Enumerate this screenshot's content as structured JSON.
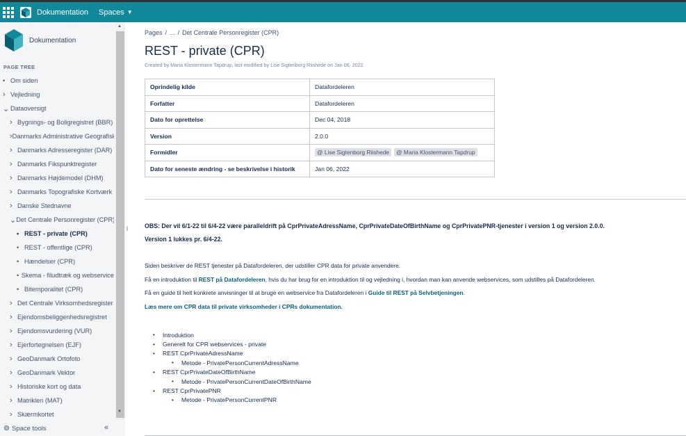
{
  "topbar": {
    "app": "Dokumentation",
    "spaces": "Spaces"
  },
  "sidebar": {
    "space_name": "Dokumentation",
    "page_tree_heading": "PAGE TREE",
    "items": [
      {
        "label": "Om siden",
        "marker": "bullet",
        "indent": 0
      },
      {
        "label": "Vejledning",
        "marker": "closed",
        "indent": 0
      },
      {
        "label": "Dataoversigt",
        "marker": "open",
        "indent": 0
      },
      {
        "label": "Bygnings- og Boligregistret (BBR)",
        "marker": "closed",
        "indent": 1
      },
      {
        "label": "Danmarks Administrative Geografiske Inddeling (DAGI)",
        "marker": "closed",
        "indent": 1
      },
      {
        "label": "Danmarks Adresseregister (DAR)",
        "marker": "closed",
        "indent": 1
      },
      {
        "label": "Danmarks Fikspunktregister",
        "marker": "closed",
        "indent": 1
      },
      {
        "label": "Danmarks Højdemodel (DHM)",
        "marker": "closed",
        "indent": 1
      },
      {
        "label": "Danmarks Topografiske Kortværk",
        "marker": "closed",
        "indent": 1
      },
      {
        "label": "Danske Stednavne",
        "marker": "closed",
        "indent": 1
      },
      {
        "label": "Det Centrale Personregister (CPR)",
        "marker": "open",
        "indent": 1
      },
      {
        "label": "REST - private (CPR)",
        "marker": "bullet",
        "indent": 2,
        "active": true
      },
      {
        "label": "REST - offentlige (CPR)",
        "marker": "bullet",
        "indent": 2
      },
      {
        "label": "Hændelser (CPR)",
        "marker": "bullet",
        "indent": 2
      },
      {
        "label": "Skema - filudtræk og webservice",
        "marker": "bullet",
        "indent": 2
      },
      {
        "label": "Bitemporalitet (CPR)",
        "marker": "bullet",
        "indent": 2
      },
      {
        "label": "Det Centrale Virksomhedsregister",
        "marker": "closed",
        "indent": 1
      },
      {
        "label": "Ejendomsbeliggenhedsregistret",
        "marker": "closed",
        "indent": 1
      },
      {
        "label": "Ejendomsvurdering (VUR)",
        "marker": "closed",
        "indent": 1
      },
      {
        "label": "Ejerfortegnelsen (EJF)",
        "marker": "closed",
        "indent": 1
      },
      {
        "label": "GeoDanmark Ortofoto",
        "marker": "closed",
        "indent": 1
      },
      {
        "label": "GeoDanmark Vektor",
        "marker": "closed",
        "indent": 1
      },
      {
        "label": "Historiske kort og data",
        "marker": "closed",
        "indent": 1
      },
      {
        "label": "Matriklen (MAT)",
        "marker": "closed",
        "indent": 1
      },
      {
        "label": "Skærmkortet",
        "marker": "closed",
        "indent": 1
      }
    ],
    "space_tools": "Space tools",
    "collapse_glyph": "«"
  },
  "breadcrumb": {
    "pages": "Pages",
    "sep": "/",
    "ellipsis": "...",
    "current": "Det Centrale Personregister (CPR)"
  },
  "page": {
    "title": "REST - private (CPR)",
    "byline": "Created by Maria Klostermann Tapdrup, last modified by Lise Sigtenborg Riishede on Jan 06, 2022"
  },
  "meta_table": [
    {
      "key": "Oprindelig kilde",
      "value": "Datafordeleren"
    },
    {
      "key": "Forfatter",
      "value": "Datafordeleren"
    },
    {
      "key": "Dato for oprettelse",
      "value": "Dec 04, 2018"
    },
    {
      "key": "Version",
      "value": "2.0.0"
    },
    {
      "key": "Formidler",
      "mentions": [
        "@ Lise Sigtenborg Riishede",
        "@ Maria Klostermann Tapdrup"
      ]
    },
    {
      "key": "Dato for seneste ændring - se beskrivelse i historik",
      "value": "Jan 06, 2022"
    }
  ],
  "obs": {
    "line1": "OBS: Der vil 6/1-22 til 6/4-22 være paralleldrift på CprPrivateAdressName, CprPrivateDateOfBirthName og CprPrivatePNR-tjenester i version 1 og version 2.0.0.",
    "line2": "Version 1 lukkes pr. 6/4-22."
  },
  "body": {
    "p1": "Siden beskriver de REST tjenester på Datafordeleren, der udstiller CPR data for private anvendere.",
    "p2_pre": "Få en introduktion til ",
    "p2_link": "REST på Datafordeleren",
    "p2_post": ", hvis du har brug for en introduktion til og vejledning i, hvordan man kan anvende webservices, som udstilles på Datafordeleren.",
    "p3_pre": "Få en guide til helt konkrete anvisninger til at bruge en webservice fra Datafordeleren i ",
    "p3_link": "Guide til REST på Selvbetjeningen",
    "p3_post": ".",
    "p4_link": "Læs mere om CPR data til private virksomheder i CPRs dokumentation."
  },
  "toc": [
    {
      "label": "Introduktion",
      "sub": false
    },
    {
      "label": "Generelt for CPR webservices - private",
      "sub": false
    },
    {
      "label": "REST CprPrivateAdressName",
      "sub": false
    },
    {
      "label": "Metode - PrivatePersonCurrentAdressName",
      "sub": true
    },
    {
      "label": "REST CprPrivateDateOfBirthName",
      "sub": false
    },
    {
      "label": "Metode - PrivatePersonCurrentDateOfBirthName",
      "sub": true
    },
    {
      "label": "REST CprPrivatePNR",
      "sub": false
    },
    {
      "label": "Metode - PrivatePersonCurrentPNR",
      "sub": true
    }
  ],
  "colors": {
    "topbar": "#12899a",
    "link": "#0b5e7a",
    "sidebar_bg": "#f4f5f7"
  }
}
